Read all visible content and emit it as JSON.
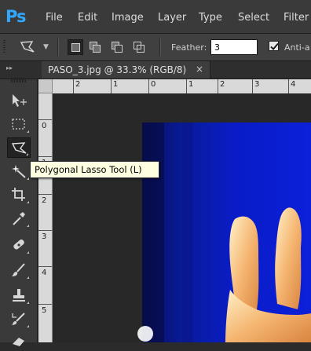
{
  "app": {
    "logo": "Ps"
  },
  "menu": [
    "File",
    "Edit",
    "Image",
    "Layer",
    "Type",
    "Select",
    "Filter"
  ],
  "options_bar": {
    "feather_label": "Feather:",
    "feather_value": "3",
    "anti_alias_label": "Anti-a",
    "anti_alias_checked": true
  },
  "document_tab": {
    "title": "PASO_3.jpg @ 33.3% (RGB/8)",
    "close": "×"
  },
  "rulers": {
    "top": [
      "2",
      "1",
      "0",
      "1",
      "2",
      "3",
      "4"
    ],
    "left": [
      "0",
      "1",
      "2",
      "3",
      "4",
      "5"
    ]
  },
  "tools": [
    {
      "name": "move-tool-icon",
      "active": false
    },
    {
      "name": "rectangular-marquee-tool-icon",
      "active": false
    },
    {
      "name": "polygonal-lasso-tool-icon",
      "active": true
    },
    {
      "name": "magic-wand-tool-icon",
      "active": false
    },
    {
      "name": "crop-tool-icon",
      "active": false
    },
    {
      "name": "eyedropper-tool-icon",
      "active": false
    },
    {
      "name": "spot-healing-brush-tool-icon",
      "active": false
    },
    {
      "name": "brush-tool-icon",
      "active": false
    },
    {
      "name": "clone-stamp-tool-icon",
      "active": false
    },
    {
      "name": "history-brush-tool-icon",
      "active": false
    },
    {
      "name": "eraser-tool-icon",
      "active": false
    }
  ],
  "tooltip": {
    "text": "Polygonal Lasso Tool (L)"
  },
  "colors": {
    "app_bg": "#2b2b2b",
    "toolbar_bg": "#3a3a3a",
    "tooltip_bg": "#ffffe1",
    "image_blue": "#0a14c8",
    "skin": "#f2b070",
    "logo": "#31a8ff"
  }
}
